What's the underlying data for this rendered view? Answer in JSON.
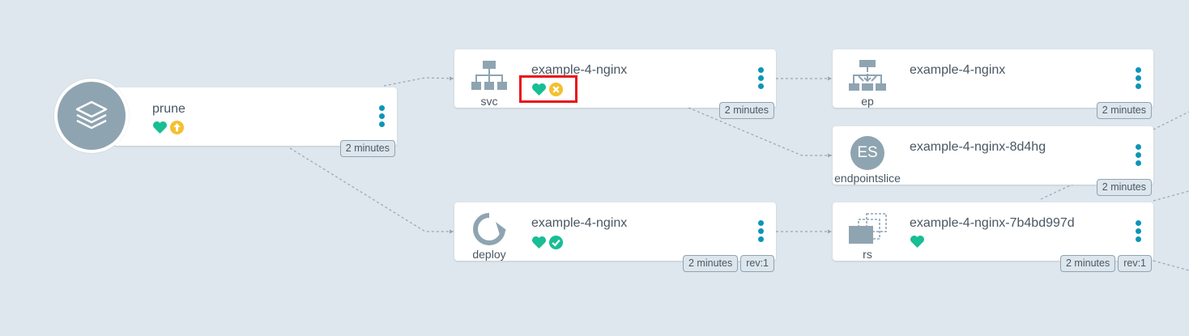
{
  "colors": {
    "background": "#dee6ee",
    "healthy": "#18be94",
    "warning": "#f4c030",
    "menu": "#0d95b8",
    "icon": "#8fa4b1",
    "highlight": "#e8141c"
  },
  "app": {
    "name": "prune",
    "age": "2 minutes",
    "icon": "layers-icon",
    "health": "heart-icon",
    "sync": "out-of-sync-arrow-icon"
  },
  "nodes": {
    "svc": {
      "name": "example-4-nginx",
      "kind": "svc",
      "age": "2 minutes"
    },
    "ep": {
      "name": "example-4-nginx",
      "kind": "ep",
      "age": "2 minutes"
    },
    "endpointslice": {
      "name": "example-4-nginx-8d4hg",
      "kind": "endpointslice",
      "icon_text": "ES",
      "age": "2 minutes"
    },
    "deploy": {
      "name": "example-4-nginx",
      "kind": "deploy",
      "age": "2 minutes",
      "rev": "rev:1"
    },
    "rs": {
      "name": "example-4-nginx-7b4bd997d",
      "kind": "rs",
      "age": "2 minutes",
      "rev": "rev:1"
    }
  }
}
